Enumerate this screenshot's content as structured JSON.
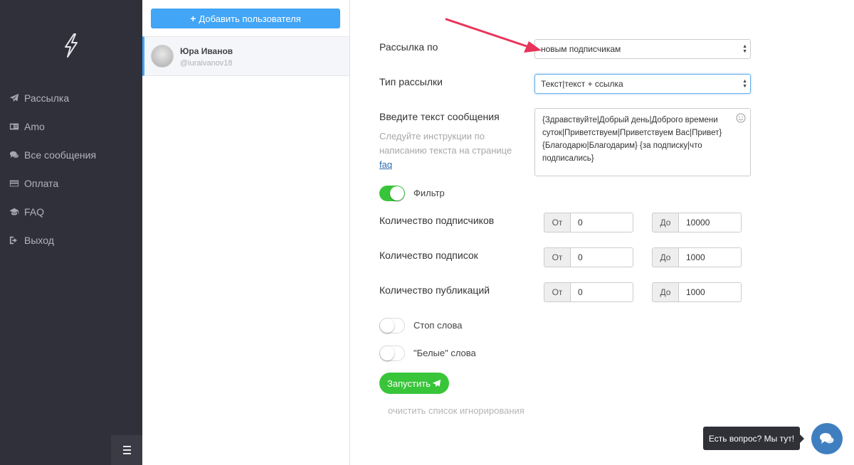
{
  "sidebar": {
    "items": [
      {
        "label": "Рассылка",
        "icon": "paper-plane-icon"
      },
      {
        "label": "Amo",
        "icon": "id-card-icon"
      },
      {
        "label": "Все сообщения",
        "icon": "comments-icon"
      },
      {
        "label": "Оплата",
        "icon": "credit-card-icon"
      },
      {
        "label": "FAQ",
        "icon": "graduation-cap-icon"
      },
      {
        "label": "Выход",
        "icon": "sign-out-icon"
      }
    ]
  },
  "users": {
    "add_button": "Добавить пользователя",
    "list": [
      {
        "name": "Юра Иванов",
        "handle": "@iuraivanov18"
      }
    ]
  },
  "form": {
    "mailing_by_label": "Рассылка по",
    "mailing_by_value": "новым подписчикам",
    "type_label": "Тип рассылки",
    "type_value": "Текст|текст + ссылка",
    "message_label": "Введите текст сообщения",
    "message_hint": "Следуйте инструкции по написанию текста на странице",
    "faq_link": "faq",
    "message_text": "{Здравствуйте|Добрый день|Доброго времени суток|Приветствуем|Приветствуем Вас|Привет}  {Благодарю|Благодарим} {за подписку|что подписались}",
    "filter_label": "Фильтр",
    "filter_on": true,
    "ranges": [
      {
        "label": "Количество подписчиков",
        "from_label": "От",
        "from": "0",
        "to_label": "До",
        "to": "10000"
      },
      {
        "label": "Количество подписок",
        "from_label": "От",
        "from": "0",
        "to_label": "До",
        "to": "1000"
      },
      {
        "label": "Количество публикаций",
        "from_label": "От",
        "from": "0",
        "to_label": "До",
        "to": "1000"
      }
    ],
    "stop_words_label": "Стоп слова",
    "stop_words_on": false,
    "white_words_label": "\"Белые\" слова",
    "white_words_on": false,
    "run_button": "Запустить",
    "clear_link": "очистить список игнорирования"
  },
  "chat": {
    "tooltip": "Есть вопрос? Мы тут!"
  },
  "colors": {
    "sidebar_bg": "#30303b",
    "primary": "#42a5f5",
    "success": "#39c53a",
    "annotation_arrow": "#e8345a"
  }
}
